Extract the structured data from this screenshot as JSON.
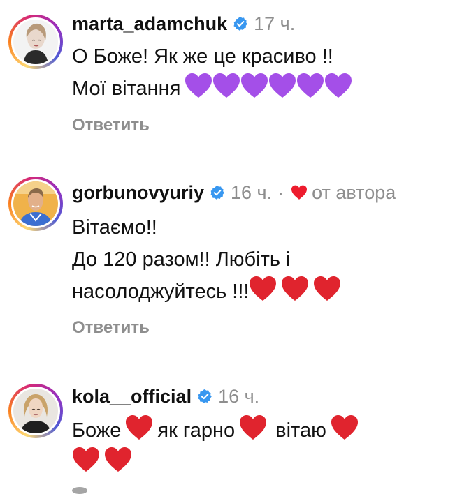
{
  "comments": [
    {
      "username": "marta_adamchuk",
      "time": "17 ч.",
      "lines": [
        "О Боже! Як же це красиво !!",
        "Мої вітання"
      ],
      "emoji_count": 6,
      "emoji": "purple-heart",
      "reply_label": "Ответить"
    },
    {
      "username": "gorbunovyuriy",
      "time": "16 ч.",
      "separator": "·",
      "author_like_label": "от автора",
      "lines": [
        "Вітаємо!!",
        "До 120 разом!! Любіть і",
        "насолоджуйтесь !!!"
      ],
      "emoji_count": 3,
      "emoji": "red-heart",
      "reply_label": "Ответить"
    },
    {
      "username": "kola__official",
      "time": "16 ч.",
      "text_parts": [
        "Боже",
        "як гарно",
        "вітаю"
      ],
      "emoji": "red-heart"
    }
  ],
  "colors": {
    "text": "#111111",
    "muted": "#8e8e8e",
    "verified": "#3897f0",
    "purple_heart": "#a44fe8",
    "red_heart": "#e0242e",
    "like_heart": "#ed1c2e"
  }
}
